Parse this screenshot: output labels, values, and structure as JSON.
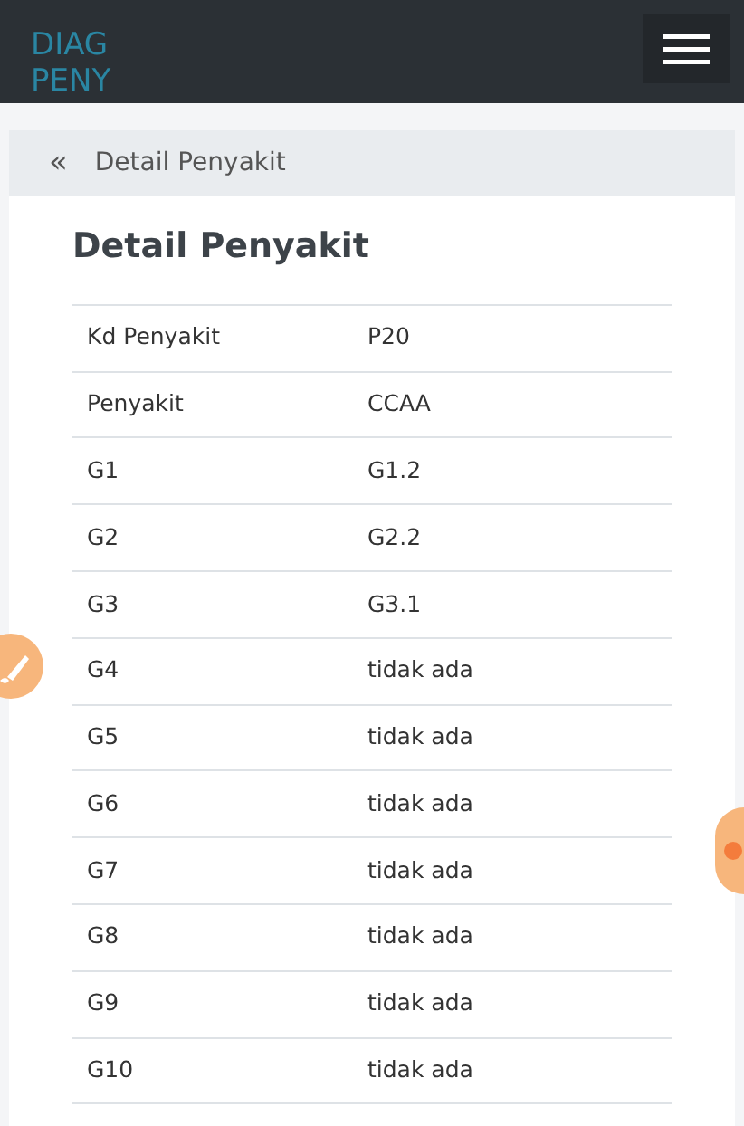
{
  "navbar": {
    "brand": "DIAG PENY"
  },
  "breadcrumb": {
    "icon": "«",
    "label": "Detail Penyakit"
  },
  "heading": "Detail Penyakit",
  "table": {
    "rows": [
      {
        "label": "Kd Penyakit",
        "value": "P20"
      },
      {
        "label": "Penyakit",
        "value": "CCAA"
      },
      {
        "label": "G1",
        "value": "G1.2"
      },
      {
        "label": "G2",
        "value": "G2.2"
      },
      {
        "label": "G3",
        "value": "G3.1"
      },
      {
        "label": "G4",
        "value": "tidak ada"
      },
      {
        "label": "G5",
        "value": "tidak ada"
      },
      {
        "label": "G6",
        "value": "tidak ada"
      },
      {
        "label": "G7",
        "value": "tidak ada"
      },
      {
        "label": "G8",
        "value": "tidak ada"
      },
      {
        "label": "G9",
        "value": "tidak ada"
      },
      {
        "label": "G10",
        "value": "tidak ada"
      }
    ]
  }
}
